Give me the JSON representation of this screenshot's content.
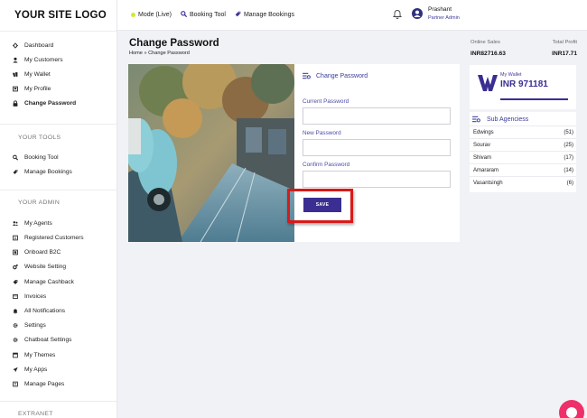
{
  "brand": {
    "logo_text": "YOUR SITE LOGO"
  },
  "sidebar": {
    "items_main": [
      {
        "label": "Dashboard",
        "icon": "dashboard-icon"
      },
      {
        "label": "My Customers",
        "icon": "user-icon"
      },
      {
        "label": "My Wallet",
        "icon": "wallet-icon"
      },
      {
        "label": "My Profile",
        "icon": "profile-icon"
      },
      {
        "label": "Change Password",
        "icon": "lock-icon",
        "active": true
      }
    ],
    "tools_title": "YOUR TOOLS",
    "items_tools": [
      {
        "label": "Booking Tool",
        "icon": "search-icon"
      },
      {
        "label": "Manage Bookings",
        "icon": "tag-icon"
      }
    ],
    "admin_title": "YOUR ADMIN",
    "items_admin": [
      {
        "label": "My Agents",
        "icon": "users-icon"
      },
      {
        "label": "Registered Customers",
        "icon": "registered-icon"
      },
      {
        "label": "Onboard B2C",
        "icon": "onboard-icon"
      },
      {
        "label": "Website Setting",
        "icon": "cogs-icon"
      },
      {
        "label": "Manage Cashback",
        "icon": "cashback-icon"
      },
      {
        "label": "Invoices",
        "icon": "invoice-icon"
      },
      {
        "label": "All Notifications",
        "icon": "bell-icon"
      },
      {
        "label": "Settings",
        "icon": "gear-icon"
      },
      {
        "label": "Chatboat Settings",
        "icon": "chat-icon"
      },
      {
        "label": "My Themes",
        "icon": "themes-icon"
      },
      {
        "label": "My Apps",
        "icon": "apps-icon"
      },
      {
        "label": "Manage Pages",
        "icon": "pages-icon"
      }
    ],
    "extranet_title": "EXTRANET"
  },
  "topbar": {
    "mode_label": "Mode (Live)",
    "booking_tool_label": "Booking Tool",
    "manage_bookings_label": "Manage Bookings",
    "user_name": "Prashant",
    "user_role": "Partner Admin"
  },
  "page": {
    "title": "Change Password",
    "breadcrumb": "Home » Change Password"
  },
  "form": {
    "heading": "Change Password",
    "current_label": "Current Password",
    "new_label": "New Password",
    "confirm_label": "Confirm Password",
    "save_label": "SAVE"
  },
  "stats": {
    "online_sales_label": "Online Sales",
    "online_sales_value": "INR82716.63",
    "total_profit_label": "Total Profit",
    "total_profit_value": "INR17.71"
  },
  "wallet": {
    "label": "My Wallet",
    "amount": "INR 971181"
  },
  "agencies": {
    "heading": "Sub Agenciess",
    "rows": [
      {
        "name": "Edwings",
        "count": "(51)"
      },
      {
        "name": "Sourav",
        "count": "(25)"
      },
      {
        "name": "Shivam",
        "count": "(17)"
      },
      {
        "name": "Amararam",
        "count": "(14)"
      },
      {
        "name": "Vasantsingh",
        "count": "(6)"
      }
    ]
  },
  "colors": {
    "brand": "#3a2e92",
    "highlight": "#d71a1a",
    "fab": "#ee2f6a"
  }
}
